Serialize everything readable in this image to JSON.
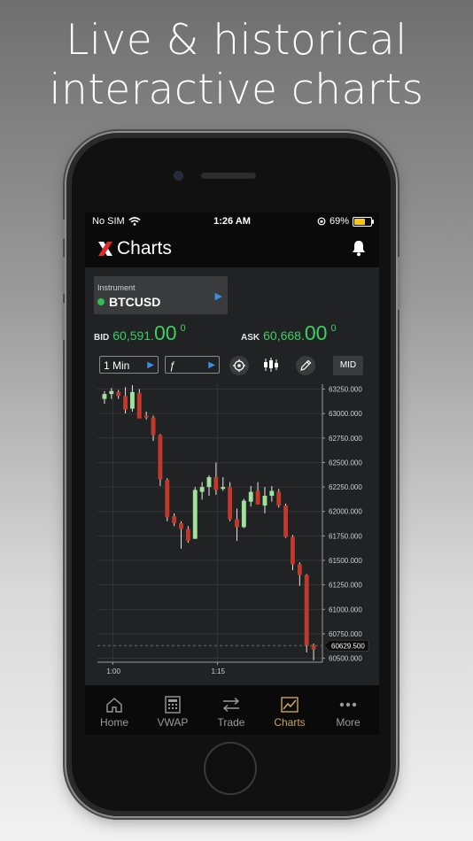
{
  "headline": {
    "line1": "Live & historical",
    "line2": "interactive charts"
  },
  "status_bar": {
    "carrier": "No SIM",
    "time": "1:26 AM",
    "battery_percent": "69%",
    "battery_level": 0.69
  },
  "nav": {
    "title": "Charts",
    "logo_icon": "x-logo-icon",
    "right_icon": "bell-icon"
  },
  "instrument": {
    "label": "Instrument",
    "symbol": "BTCUSD",
    "status_color": "#2fbf52"
  },
  "quotes": {
    "bid": {
      "label": "BID",
      "main": "60,591.",
      "big": "00",
      "sup": "0"
    },
    "ask": {
      "label": "ASK",
      "main": "60,668.",
      "big": "00",
      "sup": "0"
    },
    "color": "#3ecf63"
  },
  "toolbar": {
    "interval": "1 Min",
    "study": "ƒ",
    "price_mode": "MID",
    "icons": [
      "crosshair-icon",
      "candlestick-icon",
      "pencil-icon"
    ]
  },
  "chart_data": {
    "type": "candlestick",
    "y_ticks": [
      "63250.000",
      "63000.000",
      "62750.000",
      "62500.000",
      "62250.000",
      "62000.000",
      "61750.000",
      "61500.000",
      "61250.000",
      "61000.000",
      "60750.000",
      "60500.000"
    ],
    "x_ticks": [
      "1:00",
      "1:15"
    ],
    "ylim": [
      60460,
      63300
    ],
    "current_price_label": "60629.500",
    "current_price": 60629.5,
    "up_color": "#9fe39a",
    "down_color": "#c0392b",
    "candles": [
      {
        "o": 63150,
        "h": 63230,
        "l": 63100,
        "c": 63200
      },
      {
        "o": 63200,
        "h": 63260,
        "l": 63150,
        "c": 63230
      },
      {
        "o": 63220,
        "h": 63240,
        "l": 63150,
        "c": 63180
      },
      {
        "o": 63180,
        "h": 63270,
        "l": 63000,
        "c": 63040
      },
      {
        "o": 63050,
        "h": 63290,
        "l": 63020,
        "c": 63220
      },
      {
        "o": 63210,
        "h": 63250,
        "l": 62990,
        "c": 62950
      },
      {
        "o": 62980,
        "h": 63020,
        "l": 62940,
        "c": 62960
      },
      {
        "o": 62960,
        "h": 62980,
        "l": 62720,
        "c": 62780
      },
      {
        "o": 62780,
        "h": 62790,
        "l": 62260,
        "c": 62330
      },
      {
        "o": 62320,
        "h": 62340,
        "l": 61900,
        "c": 61940
      },
      {
        "o": 61950,
        "h": 61980,
        "l": 61850,
        "c": 61880
      },
      {
        "o": 61880,
        "h": 61900,
        "l": 61620,
        "c": 61820
      },
      {
        "o": 61820,
        "h": 61850,
        "l": 61680,
        "c": 61700
      },
      {
        "o": 61720,
        "h": 62250,
        "l": 61720,
        "c": 62220
      },
      {
        "o": 62200,
        "h": 62300,
        "l": 62120,
        "c": 62250
      },
      {
        "o": 62250,
        "h": 62370,
        "l": 62160,
        "c": 62350
      },
      {
        "o": 62350,
        "h": 62500,
        "l": 62170,
        "c": 62220
      },
      {
        "o": 62230,
        "h": 62350,
        "l": 62210,
        "c": 62250
      },
      {
        "o": 62250,
        "h": 62300,
        "l": 61900,
        "c": 61920
      },
      {
        "o": 61920,
        "h": 62030,
        "l": 61700,
        "c": 61840
      },
      {
        "o": 61840,
        "h": 62130,
        "l": 61830,
        "c": 62110
      },
      {
        "o": 62100,
        "h": 62260,
        "l": 62050,
        "c": 62200
      },
      {
        "o": 62210,
        "h": 62300,
        "l": 62070,
        "c": 62070
      },
      {
        "o": 62060,
        "h": 62250,
        "l": 61980,
        "c": 62160
      },
      {
        "o": 62160,
        "h": 62260,
        "l": 62100,
        "c": 62210
      },
      {
        "o": 62200,
        "h": 62230,
        "l": 62040,
        "c": 62060
      },
      {
        "o": 62060,
        "h": 62080,
        "l": 61730,
        "c": 61740
      },
      {
        "o": 61740,
        "h": 61760,
        "l": 61400,
        "c": 61460
      },
      {
        "o": 61460,
        "h": 61480,
        "l": 61240,
        "c": 61350
      },
      {
        "o": 61350,
        "h": 61360,
        "l": 60560,
        "c": 60630
      },
      {
        "o": 60630,
        "h": 60650,
        "l": 60480,
        "c": 60590
      }
    ]
  },
  "tabs": [
    {
      "label": "Home",
      "icon": "home-icon"
    },
    {
      "label": "VWAP",
      "icon": "calculator-icon"
    },
    {
      "label": "Trade",
      "icon": "swap-arrows-icon"
    },
    {
      "label": "Charts",
      "icon": "chart-icon",
      "active": true
    },
    {
      "label": "More",
      "icon": "more-dots-icon"
    }
  ],
  "accent_color": "#c9a55c"
}
